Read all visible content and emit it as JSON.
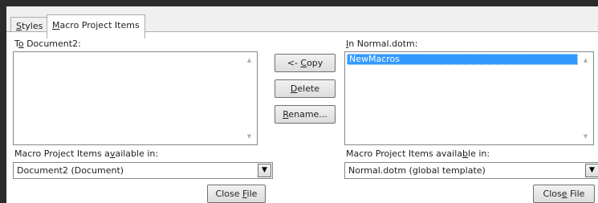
{
  "tabs": [
    {
      "pre": "",
      "mn": "S",
      "post": "tyles"
    },
    {
      "pre": "",
      "mn": "M",
      "post": "acro Project Items"
    }
  ],
  "left": {
    "list_label": {
      "pre": "T",
      "mn": "o",
      "post": " Document2:"
    },
    "items": [],
    "available_label": {
      "pre": "Macro Project Items a",
      "mn": "v",
      "post": "ailable in:"
    },
    "available_value": "Document2 (Document)",
    "close_button": {
      "pre": "Close ",
      "mn": "F",
      "post": "ile"
    }
  },
  "middle": {
    "copy_button": {
      "pre": "<- ",
      "mn": "C",
      "post": "opy"
    },
    "delete_button": {
      "pre": "",
      "mn": "D",
      "post": "elete"
    },
    "rename_button": {
      "pre": "",
      "mn": "R",
      "post": "ename..."
    }
  },
  "right": {
    "list_label": {
      "pre": "",
      "mn": "I",
      "post": "n Normal.dotm:"
    },
    "items": [
      "NewMacros"
    ],
    "available_label": {
      "pre": "Macro Project Items availa",
      "mn": "b",
      "post": "le in:"
    },
    "available_value": "Normal.dotm (global template)",
    "close_button": {
      "pre": "Clos",
      "mn": "e",
      "post": " File"
    }
  },
  "colors": {
    "selection": "#3399ff",
    "frame": "#2b2b2b",
    "border": "#828790"
  }
}
